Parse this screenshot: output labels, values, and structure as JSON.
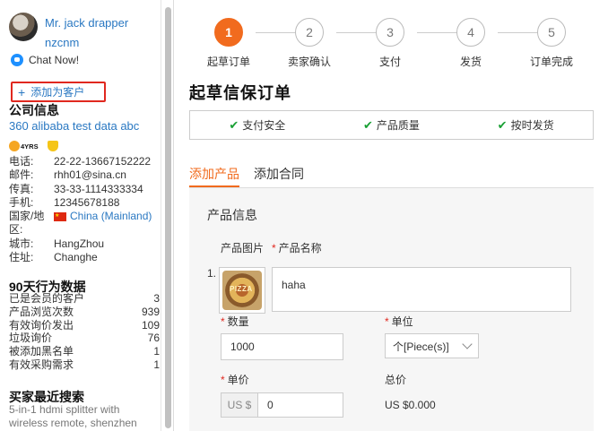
{
  "sidebar": {
    "user_name": "Mr. jack drapper",
    "user_id": "nzcnm",
    "chat_label": "Chat Now!",
    "add_customer_label": "添加为客户",
    "company_section_title": "公司信息",
    "company_name": "360 alibaba test data abc",
    "years_badge": "4YRS",
    "info": [
      {
        "key": "电话:",
        "value": "22-22-13667152222"
      },
      {
        "key": "邮件:",
        "value": "rhh01@sina.cn"
      },
      {
        "key": "传真:",
        "value": "33-33-1114333334"
      },
      {
        "key": "手机:",
        "value": "12345678188"
      },
      {
        "key": "国家/地",
        "value": "China (Mainland)"
      },
      {
        "key": "区:",
        "value": ""
      },
      {
        "key": "城市:",
        "value": "HangZhou"
      },
      {
        "key": "住址:",
        "value": "Changhe"
      }
    ],
    "behavior_section_title": "90天行为数据",
    "stats": [
      {
        "label": "已是会员的客户",
        "value": "3"
      },
      {
        "label": "产品浏览次数",
        "value": "939"
      },
      {
        "label": "有效询价发出",
        "value": "109"
      },
      {
        "label": "垃圾询价",
        "value": "76"
      },
      {
        "label": "被添加黑名单",
        "value": "1"
      },
      {
        "label": "有效采购需求",
        "value": "1"
      }
    ],
    "search_section_title": "买家最近搜索",
    "recent_search": "5-in-1 hdmi splitter with wireless remote, shenzhen"
  },
  "steps": [
    {
      "num": "1",
      "label": "起草订单",
      "active": true
    },
    {
      "num": "2",
      "label": "卖家确认",
      "active": false
    },
    {
      "num": "3",
      "label": "支付",
      "active": false
    },
    {
      "num": "4",
      "label": "发货",
      "active": false
    },
    {
      "num": "5",
      "label": "订单完成",
      "active": false
    }
  ],
  "main": {
    "page_title": "起草信保订单",
    "assurances": [
      "支付安全",
      "产品质量",
      "按时发货"
    ],
    "tabs": [
      {
        "label": "添加产品",
        "active": true
      },
      {
        "label": "添加合同",
        "active": false
      }
    ],
    "panel_title": "产品信息",
    "col_image": "产品图片",
    "col_name": "产品名称",
    "row_number": "1.",
    "product_name_value": "haha",
    "quantity_label": "数量",
    "quantity_value": "1000",
    "unit_label": "单位",
    "unit_value": "个[Piece(s)]",
    "price_label": "单价",
    "currency_prefix": "US $",
    "price_value": "0",
    "total_label": "总价",
    "total_value": "US $0.000"
  },
  "colors": {
    "accent": "#f16b1e",
    "link": "#2a78c2",
    "required": "#e0281f",
    "check": "#19a034"
  }
}
